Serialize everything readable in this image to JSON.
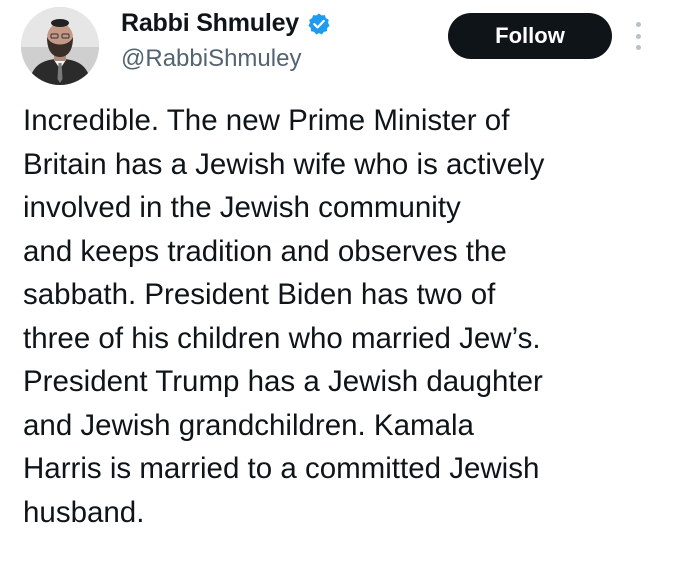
{
  "author": {
    "display_name": "Rabbi Shmuley",
    "handle": "@RabbiShmuley",
    "verified": true,
    "verified_badge_color": "#1d9bf0",
    "avatar_icon": "profile-photo"
  },
  "actions": {
    "follow_label": "Follow",
    "more_icon": "vertical-ellipsis-icon"
  },
  "tweet": {
    "lines": [
      "Incredible. The new Prime Minister of",
      "Britain has a Jewish wife who is actively",
      "involved in the Jewish community",
      "and keeps tradition and observes the",
      "sabbath. President Biden has two of",
      "three of his children who married Jew’s.",
      "President Trump has a Jewish daughter",
      "and Jewish grandchildren. Kamala",
      "Harris is married to a committed Jewish",
      "husband."
    ]
  },
  "colors": {
    "text_primary": "#0f1419",
    "text_secondary": "#536471",
    "button_bg": "#0f1419",
    "button_text": "#ffffff"
  }
}
